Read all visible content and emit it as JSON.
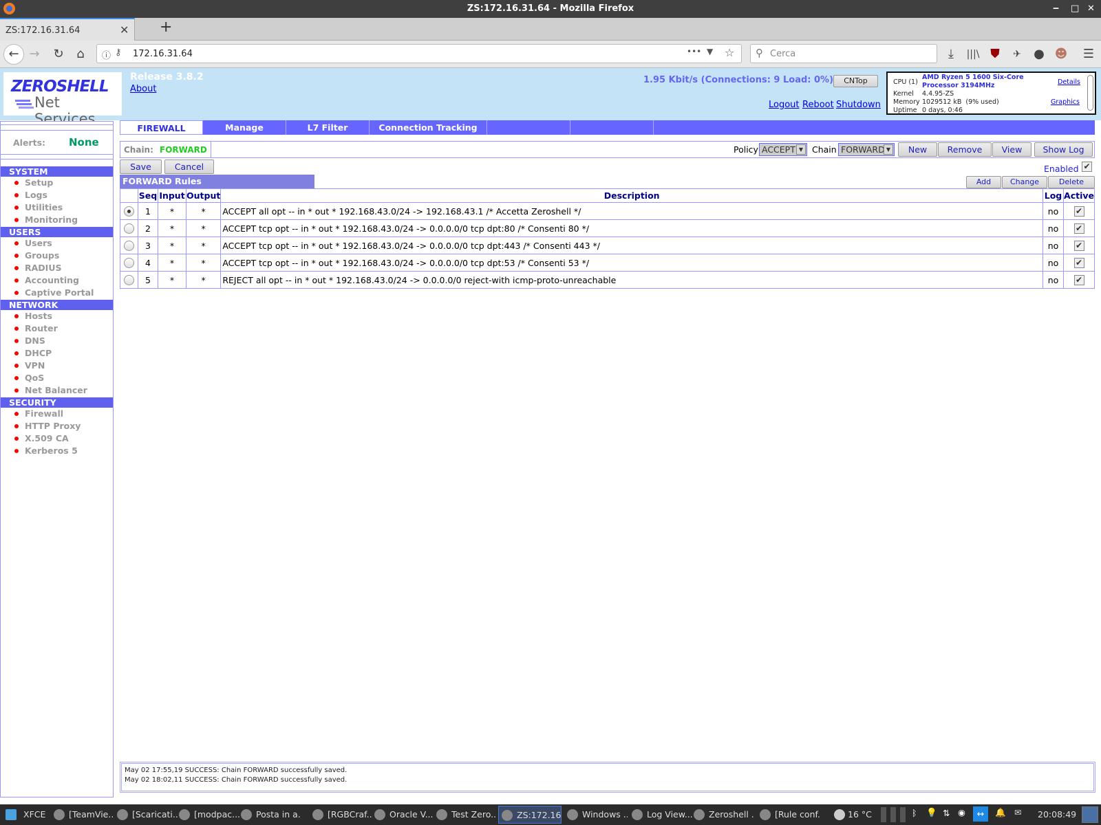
{
  "window": {
    "title": "ZS:172.16.31.64 - Mozilla Firefox",
    "minimize": "‒",
    "maximize": "□",
    "close": "✕"
  },
  "browser": {
    "tab_title": "ZS:172.16.31.64",
    "url": "172.16.31.64",
    "search_placeholder": "Cerca"
  },
  "header": {
    "logo_title": "ZEROSHELL",
    "logo_subtitle": "Net Services",
    "release": "Release 3.8.2",
    "about": "About",
    "stats": "1.95 Kbit/s (Connections: 9 Load: 0%)",
    "cntop": "CNTop",
    "logout": "Logout",
    "reboot": "Reboot",
    "shutdown": "Shutdown",
    "sysinfo": {
      "cpu_label": "CPU (1)",
      "cpu": "AMD Ryzen 5 1600 Six-Core Processor 3194MHz",
      "kernel_label": "Kernel",
      "kernel": "4.4.95-ZS",
      "memory_label": "Memory",
      "memory": "1029512 kB  (9% used)",
      "uptime_label": "Uptime",
      "uptime": "0 days, 0:46",
      "details": "Details",
      "graphics": "Graphics"
    }
  },
  "sidebar": {
    "alerts_label": "Alerts:",
    "alerts_value": "None",
    "sections": [
      {
        "title": "SYSTEM",
        "items": [
          "Setup",
          "Logs",
          "Utilities",
          "Monitoring"
        ]
      },
      {
        "title": "USERS",
        "items": [
          "Users",
          "Groups",
          "RADIUS",
          "Accounting",
          "Captive Portal"
        ]
      },
      {
        "title": "NETWORK",
        "items": [
          "Hosts",
          "Router",
          "DNS",
          "DHCP",
          "VPN",
          "QoS",
          "Net Balancer"
        ]
      },
      {
        "title": "SECURITY",
        "items": [
          "Firewall",
          "HTTP Proxy",
          "X.509 CA",
          "Kerberos 5"
        ]
      }
    ]
  },
  "tabs": [
    "FIREWALL",
    "Manage",
    "L7 Filter",
    "Connection Tracking"
  ],
  "chain_bar": {
    "chain_label": "Chain:",
    "chain_value": "FORWARD",
    "policy_label": "Policy",
    "policy_value": "ACCEPT",
    "chain_select_label": "Chain",
    "chain_select_value": "FORWARD",
    "new": "New",
    "remove": "Remove",
    "view": "View",
    "show_log": "Show Log"
  },
  "actions": {
    "save": "Save",
    "cancel": "Cancel",
    "enabled": "Enabled",
    "add": "Add",
    "change": "Change",
    "delete": "Delete"
  },
  "rules": {
    "title": "FORWARD Rules",
    "headers": [
      "",
      "Seq",
      "Input",
      "Output",
      "Description",
      "Log",
      "Active"
    ],
    "rows": [
      {
        "selected": true,
        "seq": "1",
        "input": "*",
        "output": "*",
        "description": "ACCEPT all opt -- in * out * 192.168.43.0/24 -> 192.168.43.1 /* Accetta Zeroshell */",
        "log": "no",
        "active": true
      },
      {
        "selected": false,
        "seq": "2",
        "input": "*",
        "output": "*",
        "description": "ACCEPT tcp opt -- in * out * 192.168.43.0/24 -> 0.0.0.0/0 tcp dpt:80 /* Consenti 80 */",
        "log": "no",
        "active": true
      },
      {
        "selected": false,
        "seq": "3",
        "input": "*",
        "output": "*",
        "description": "ACCEPT tcp opt -- in * out * 192.168.43.0/24 -> 0.0.0.0/0 tcp dpt:443 /* Consenti 443 */",
        "log": "no",
        "active": true
      },
      {
        "selected": false,
        "seq": "4",
        "input": "*",
        "output": "*",
        "description": "ACCEPT tcp opt -- in * out * 192.168.43.0/24 -> 0.0.0.0/0 tcp dpt:53 /* Consenti 53 */",
        "log": "no",
        "active": true
      },
      {
        "selected": false,
        "seq": "5",
        "input": "*",
        "output": "*",
        "description": "REJECT all opt -- in * out * 192.168.43.0/24 -> 0.0.0.0/0 reject-with icmp-proto-unreachable",
        "log": "no",
        "active": true
      }
    ]
  },
  "log_messages": [
    "May 02 17:55,19 SUCCESS: Chain FORWARD successfully saved.",
    "May 02 18:02,11 SUCCESS: Chain FORWARD successfully saved."
  ],
  "taskbar": {
    "start": "XFCE",
    "tasks": [
      "[TeamVie...",
      "[Scaricati...",
      "[modpac...",
      "Posta in a...",
      "[RGBCraf...",
      "Oracle V...",
      "Test Zero...",
      "ZS:172.16...",
      "Windows ...",
      "Log View...",
      "Zeroshell ...",
      "[Rule conf..."
    ],
    "active_task": 7,
    "weather": "16 °C",
    "clock": "20:08:49"
  }
}
